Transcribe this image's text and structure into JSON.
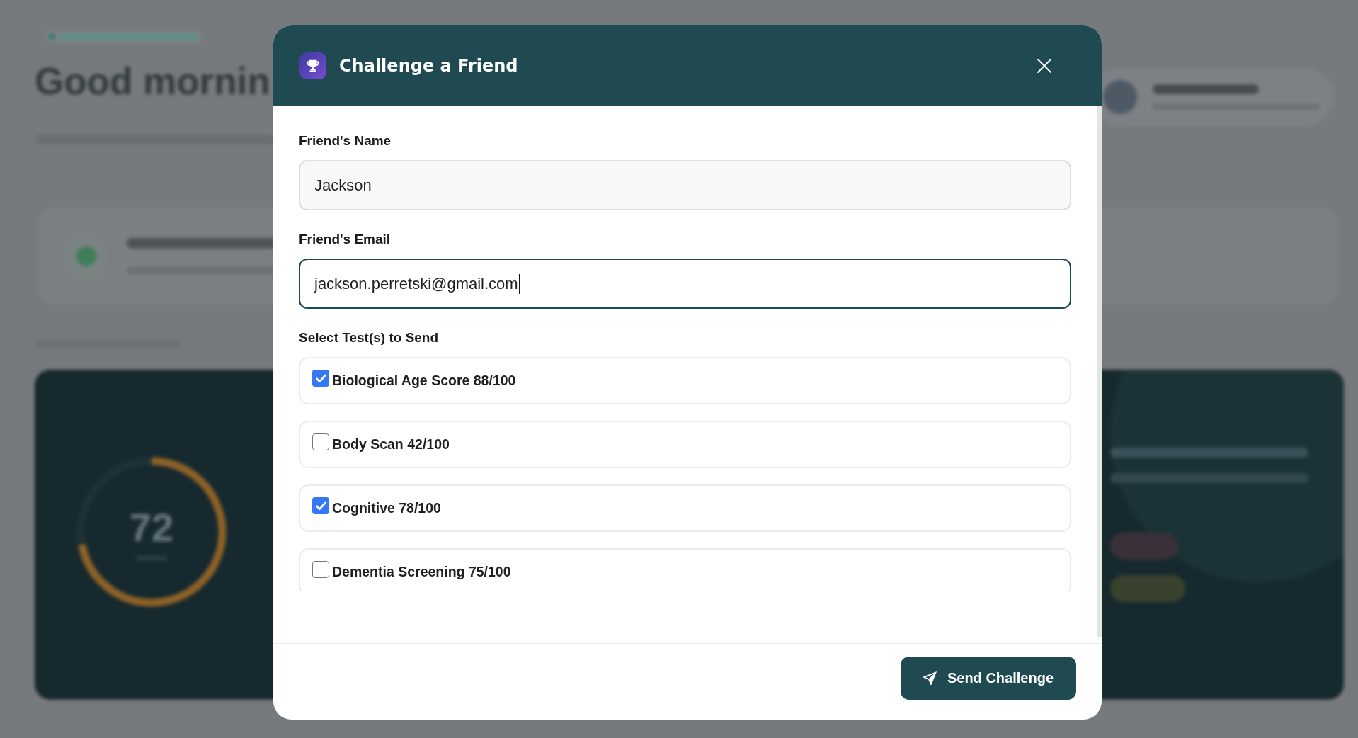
{
  "backdrop": {
    "greeting": "Good mornin",
    "score_ring": {
      "value": "72",
      "level": 0.72
    }
  },
  "dialog": {
    "title": "Challenge a Friend",
    "fields": [
      {
        "label": "Friend's Name",
        "value": "Jackson",
        "focused": false
      },
      {
        "label": "Friend's Email",
        "value": "jackson.perretski@gmail.com",
        "focused": true
      }
    ],
    "tests_label": "Select Test(s) to Send",
    "tests": [
      {
        "label": "Biological Age Score 88/100",
        "checked": true
      },
      {
        "label": "Body Scan 42/100",
        "checked": false
      },
      {
        "label": "Cognitive 78/100",
        "checked": true
      },
      {
        "label": "Dementia Screening 75/100",
        "checked": false
      }
    ],
    "submit": "Send Challenge"
  }
}
